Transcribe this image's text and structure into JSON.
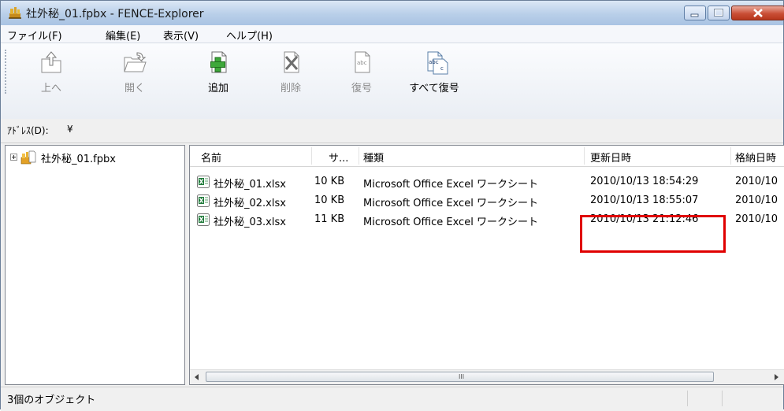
{
  "window": {
    "title": "社外秘_01.fpbx - FENCE-Explorer"
  },
  "menu": [
    "ファイル(F)",
    "編集(E)",
    "表示(V)",
    "ヘルプ(H)"
  ],
  "toolbar": {
    "up": {
      "label": "上へ",
      "enabled": false,
      "icon": "folder-up-icon"
    },
    "open": {
      "label": "開く",
      "enabled": false,
      "icon": "folder-open-icon"
    },
    "add": {
      "label": "追加",
      "enabled": true,
      "icon": "add-file-icon"
    },
    "delete": {
      "label": "削除",
      "enabled": false,
      "icon": "delete-file-icon"
    },
    "decrypt": {
      "label": "復号",
      "enabled": false,
      "icon": "decrypt-icon"
    },
    "decrypt_all": {
      "label": "すべて復号",
      "enabled": true,
      "icon": "decrypt-all-icon"
    }
  },
  "address": {
    "label": "ｱﾄﾞﾚｽ(D):",
    "value": "¥"
  },
  "tree": {
    "root": "社外秘_01.fpbx"
  },
  "list": {
    "columns": [
      "名前",
      "サ...",
      "種類",
      "更新日時",
      "格納日時"
    ],
    "rows": [
      {
        "name": "社外秘_01.xlsx",
        "size": "10 KB",
        "type": "Microsoft Office Excel ワークシート",
        "modified": "2010/10/13 18:54:29",
        "stored": "2010/10"
      },
      {
        "name": "社外秘_02.xlsx",
        "size": "10 KB",
        "type": "Microsoft Office Excel ワークシート",
        "modified": "2010/10/13 18:55:07",
        "stored": "2010/10"
      },
      {
        "name": "社外秘_03.xlsx",
        "size": "11 KB",
        "type": "Microsoft Office Excel ワークシート",
        "modified": "2010/10/13 21:12:46",
        "stored": "2010/10"
      }
    ],
    "scroll_grip": "III"
  },
  "status": {
    "text": "3個のオブジェクト"
  },
  "colors": {
    "highlight": "#e00000",
    "title_gradient_top": "#dbe7f5",
    "close_button": "#c94f36"
  }
}
